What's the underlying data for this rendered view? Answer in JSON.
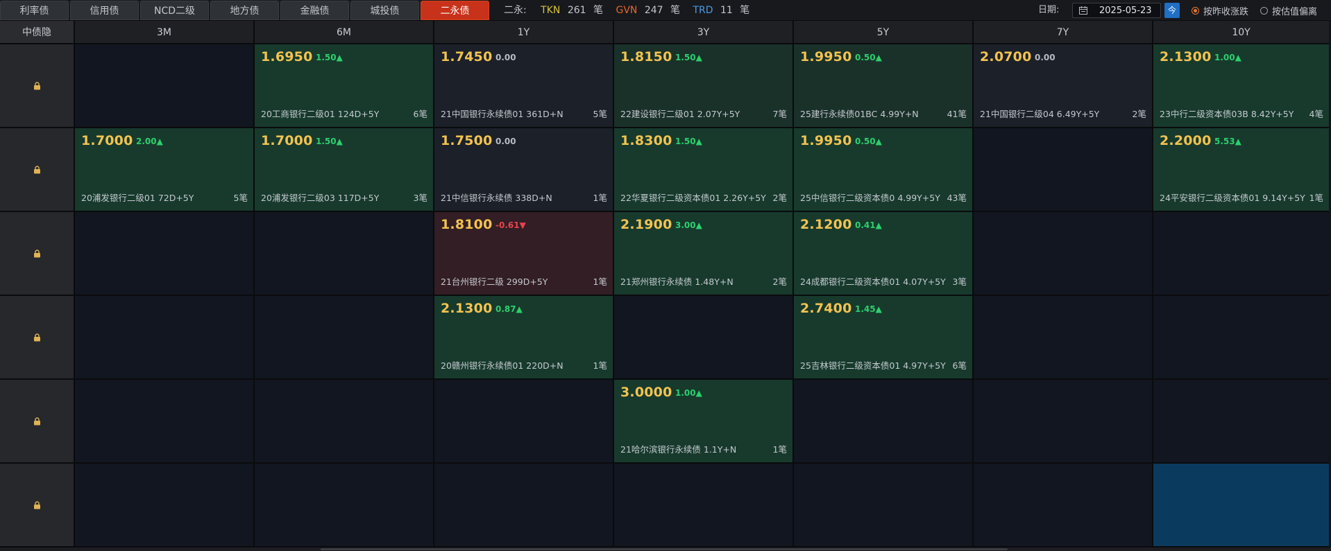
{
  "tabs": [
    {
      "label": "利率债",
      "active": false
    },
    {
      "label": "信用债",
      "active": false
    },
    {
      "label": "NCD二级",
      "active": false
    },
    {
      "label": "地方债",
      "active": false
    },
    {
      "label": "金融债",
      "active": false
    },
    {
      "label": "城投债",
      "active": false
    },
    {
      "label": "二永债",
      "active": true
    }
  ],
  "summary": {
    "label": "二永:",
    "tkn_label": "TKN",
    "tkn_count": "261",
    "gvn_label": "GVN",
    "gvn_count": "247",
    "trd_label": "TRD",
    "trd_count": "11",
    "unit": "笔"
  },
  "date": {
    "label": "日期:",
    "value": "2025-05-23",
    "today_label": "今"
  },
  "radios": [
    {
      "label": "按昨收涨跌",
      "checked": true
    },
    {
      "label": "按估值偏离",
      "checked": false
    }
  ],
  "grid": {
    "corner_label": "中债隐",
    "columns": [
      "3M",
      "6M",
      "1Y",
      "3Y",
      "5Y",
      "7Y",
      "10Y"
    ],
    "rows": [
      [
        null,
        {
          "price": "1.6950",
          "change": "1.50▲",
          "dir": "up",
          "name": "20工商银行二级01 124D+5Y",
          "count": "6笔"
        },
        {
          "price": "1.7450",
          "change": "0.00",
          "dir": "flat",
          "name": "21中国银行永续债01 361D+N",
          "count": "5笔"
        },
        {
          "price": "1.8150",
          "change": "1.50▲",
          "dir": "up",
          "name": "22建设银行二级01 2.07Y+5Y",
          "count": "7笔"
        },
        {
          "price": "1.9950",
          "change": "0.50▲",
          "dir": "up",
          "name": "25建行永续债01BC 4.99Y+N",
          "count": "41笔"
        },
        {
          "price": "2.0700",
          "change": "0.00",
          "dir": "flat",
          "name": "21中国银行二级04 6.49Y+5Y",
          "count": "2笔"
        },
        {
          "price": "2.1300",
          "change": "1.00▲",
          "dir": "up",
          "name": "23中行二级资本债03B 8.42Y+5Y",
          "count": "4笔"
        }
      ],
      [
        {
          "price": "1.7000",
          "change": "2.00▲",
          "dir": "up",
          "name": "20浦发银行二级01 72D+5Y",
          "count": "5笔"
        },
        {
          "price": "1.7000",
          "change": "1.50▲",
          "dir": "up",
          "name": "20浦发银行二级03 117D+5Y",
          "count": "3笔"
        },
        {
          "price": "1.7500",
          "change": "0.00",
          "dir": "flat",
          "name": "21中信银行永续债 338D+N",
          "count": "1笔"
        },
        {
          "price": "1.8300",
          "change": "1.50▲",
          "dir": "up",
          "name": "22华夏银行二级资本债01 2.26Y+5Y",
          "count": "2笔"
        },
        {
          "price": "1.9950",
          "change": "0.50▲",
          "dir": "up",
          "name": "25中信银行二级资本债0 4.99Y+5Y",
          "count": "43笔"
        },
        null,
        {
          "price": "2.2000",
          "change": "5.53▲",
          "dir": "up",
          "name": "24平安银行二级资本债01 9.14Y+5Y",
          "count": "1笔"
        }
      ],
      [
        null,
        null,
        {
          "price": "1.8100",
          "change": "-0.61▼",
          "dir": "down",
          "name": "21台州银行二级 299D+5Y",
          "count": "1笔"
        },
        {
          "price": "2.1900",
          "change": "3.00▲",
          "dir": "up",
          "name": "21郑州银行永续债 1.48Y+N",
          "count": "2笔"
        },
        {
          "price": "2.1200",
          "change": "0.41▲",
          "dir": "up",
          "name": "24成都银行二级资本债01 4.07Y+5Y",
          "count": "3笔"
        },
        null,
        null
      ],
      [
        null,
        null,
        {
          "price": "2.1300",
          "change": "0.87▲",
          "dir": "up",
          "name": "20赣州银行永续债01 220D+N",
          "count": "1笔"
        },
        null,
        {
          "price": "2.7400",
          "change": "1.45▲",
          "dir": "up",
          "name": "25吉林银行二级资本债01 4.97Y+5Y",
          "count": "6笔"
        },
        null,
        null
      ],
      [
        null,
        null,
        null,
        {
          "price": "3.0000",
          "change": "1.00▲",
          "dir": "up",
          "name": "21哈尔滨银行永续债 1.1Y+N",
          "count": "1笔"
        },
        null,
        null,
        null
      ],
      [
        null,
        null,
        null,
        null,
        null,
        null,
        null
      ]
    ]
  },
  "colors": {
    "accent_tab": "#c8321a",
    "price": "#f2c350",
    "up": "#2ccf6c",
    "down": "#e8434e",
    "selected_cell": "#0b3a5f"
  },
  "icons": {
    "row_lock": "lock-icon",
    "date": "calendar-icon"
  }
}
